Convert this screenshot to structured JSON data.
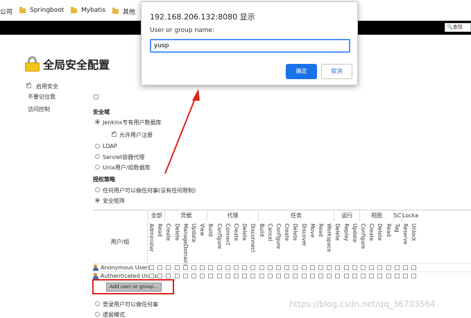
{
  "bookmarks": [
    {
      "label": "公司",
      "folder": false
    },
    {
      "label": "Springboot",
      "folder": true
    },
    {
      "label": "Mybatis",
      "folder": true
    },
    {
      "label": "其他",
      "folder": true
    }
  ],
  "header": {
    "search_placeholder": "查找"
  },
  "page": {
    "title": "全局安全配置"
  },
  "options": {
    "enable_security": "启用安全",
    "dont_remember": "不要记住我",
    "access_control": "访问控制"
  },
  "realm": {
    "title": "安全域",
    "items": [
      "Jenkins专有用户数据库",
      "LDAP",
      "Servlet容器代理",
      "Unix用户/组数据库"
    ],
    "selected_index": 0,
    "allow_signup": "允许用户注册"
  },
  "authorization": {
    "title": "授权策略",
    "items": [
      "任何用户可以做任何事(没有任何限制)",
      "安全矩阵",
      "登录用户可以做任何事",
      "遗留模式"
    ],
    "selected_index": 1
  },
  "matrix": {
    "user_header": "用户/组",
    "groups": [
      {
        "label": "全部",
        "perms": [
          "Administer",
          "Read"
        ]
      },
      {
        "label": "凭据",
        "perms": [
          "Create",
          "Delete",
          "ManageDomains",
          "Update",
          "View"
        ]
      },
      {
        "label": "代理",
        "perms": [
          "Build",
          "Configure",
          "Connect",
          "Create",
          "Delete",
          "Disconnect"
        ]
      },
      {
        "label": "任务",
        "perms": [
          "Build",
          "Cancel",
          "Configure",
          "Create",
          "Delete",
          "Discover",
          "Move",
          "Read",
          "Workspace"
        ]
      },
      {
        "label": "运行",
        "perms": [
          "Delete",
          "Replay",
          "Update"
        ]
      },
      {
        "label": "视图",
        "perms": [
          "Configure",
          "Create",
          "Delete",
          "Read"
        ]
      },
      {
        "label": "SCM",
        "perms": [
          "Tag"
        ]
      },
      {
        "label": "Lockable Resources",
        "perms": [
          "Reserve",
          "Unlock"
        ]
      }
    ],
    "users": [
      "Anonymous Users",
      "Authenticated Users"
    ],
    "add_button": "Add user or group..."
  },
  "dialog": {
    "title": "192.168.206.132:8080 显示",
    "message": "User or group name:",
    "input_value": "yusp",
    "ok": "确定",
    "cancel": "取消"
  },
  "watermark": "https://blog.csdn.net/qq_36703564",
  "colors": {
    "primary_button": "#1a73e8",
    "highlight_box": "#e0211c",
    "arrow": "#e0211c"
  }
}
